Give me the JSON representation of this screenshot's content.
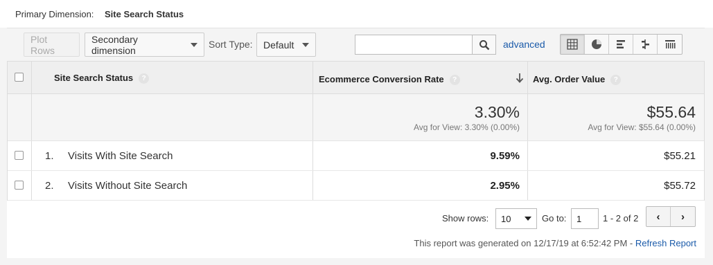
{
  "primary_dimension": {
    "label": "Primary Dimension:",
    "value": "Site Search Status"
  },
  "toolbar": {
    "plot_rows": "Plot Rows",
    "secondary_dimension": "Secondary dimension",
    "sort_type_label": "Sort Type:",
    "sort_type_value": "Default",
    "search_value": "",
    "advanced": "advanced",
    "view_icons": [
      "table-view-icon",
      "pie-view-icon",
      "performance-view-icon",
      "comparison-view-icon",
      "pivot-view-icon"
    ]
  },
  "table": {
    "headers": {
      "dimension": "Site Search Status",
      "metric1": "Ecommerce Conversion Rate",
      "metric2": "Avg. Order Value",
      "help": "?"
    },
    "totals": {
      "metric1_value": "3.30%",
      "metric1_sub": "Avg for View: 3.30% (0.00%)",
      "metric2_value": "$55.64",
      "metric2_sub": "Avg for View: $55.64 (0.00%)"
    },
    "rows": [
      {
        "index": "1.",
        "name": "Visits With Site Search",
        "rate": "9.59%",
        "aov": "$55.21"
      },
      {
        "index": "2.",
        "name": "Visits Without Site Search",
        "rate": "2.95%",
        "aov": "$55.72"
      }
    ]
  },
  "footer": {
    "show_rows_label": "Show rows:",
    "show_rows_value": "10",
    "goto_label": "Go to:",
    "goto_value": "1",
    "range": "1 - 2 of 2",
    "prev": "‹",
    "next": "›",
    "generated": "This report was generated on 12/17/19 at 6:52:42 PM - ",
    "refresh": "Refresh Report"
  },
  "colors": {
    "link": "#1a5aa9",
    "header_bg": "#efefef"
  }
}
